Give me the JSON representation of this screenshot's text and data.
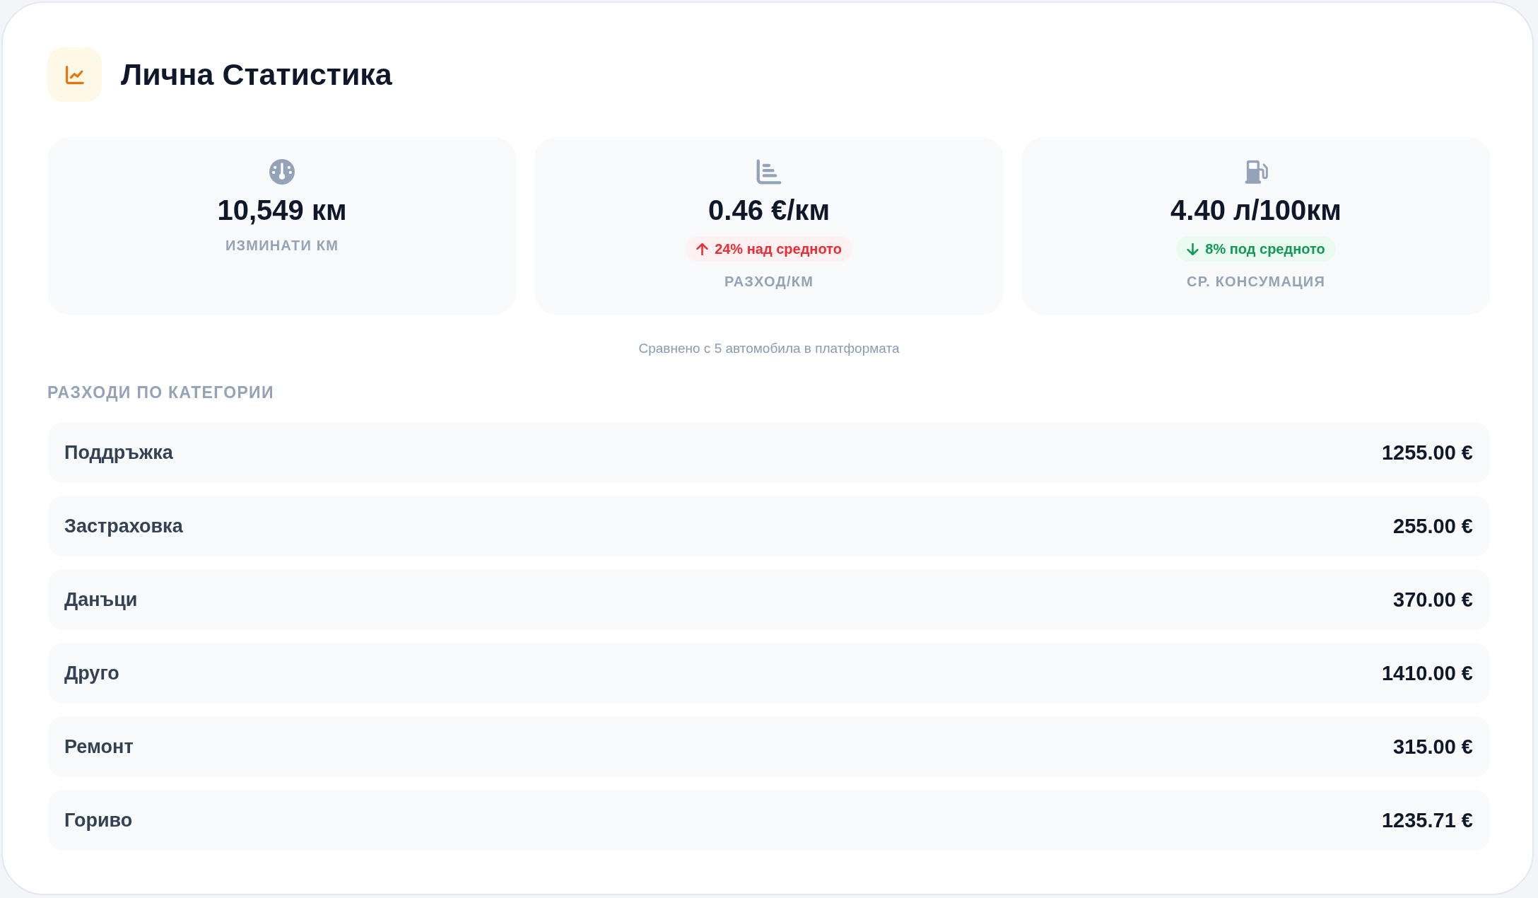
{
  "header": {
    "title": "Лична Статистика"
  },
  "stats": [
    {
      "value": "10,549 км",
      "label": "ИЗМИНАТИ КМ"
    },
    {
      "value": "0.46 €/км",
      "comparison": {
        "text": "24% над средното",
        "above_average": true
      },
      "label": "РАЗХОД/КМ"
    },
    {
      "value": "4.40 л/100км",
      "comparison": {
        "text": "8% под средното",
        "above_average": false
      },
      "label": "СР. КОНСУМАЦИЯ"
    }
  ],
  "comparison_note": "Сравнено с 5 автомобила в платформата",
  "categories": {
    "heading": "РАЗХОДИ ПО КАТЕГОРИИ",
    "items": [
      {
        "name": "Поддръжка",
        "amount": "1255.00 €"
      },
      {
        "name": "Застраховка",
        "amount": "255.00 €"
      },
      {
        "name": "Данъци",
        "amount": "370.00 €"
      },
      {
        "name": "Друго",
        "amount": "1410.00 €"
      },
      {
        "name": "Ремонт",
        "amount": "315.00 €"
      },
      {
        "name": "Гориво",
        "amount": "1235.71 €"
      }
    ]
  }
}
